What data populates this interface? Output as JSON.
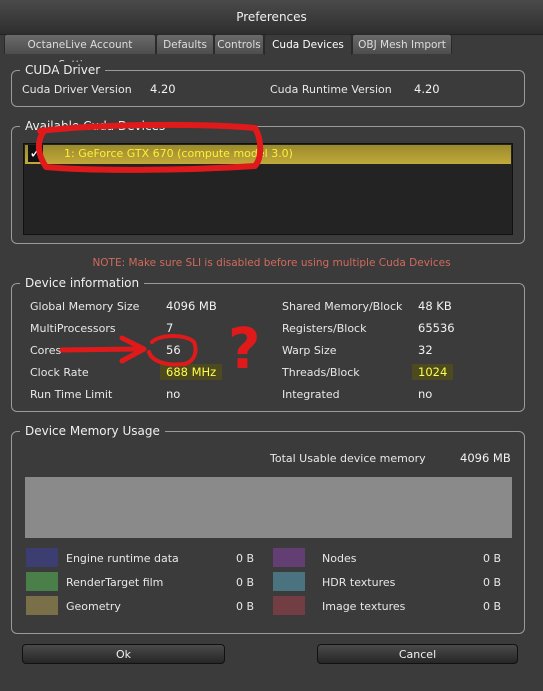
{
  "window": {
    "title": "Preferences"
  },
  "tabs": [
    {
      "label": "OctaneLive Account Settings"
    },
    {
      "label": "Defaults"
    },
    {
      "label": "Controls"
    },
    {
      "label": "Cuda Devices",
      "active": true
    },
    {
      "label": "OBJ Mesh Import"
    }
  ],
  "cuda_driver": {
    "title": "CUDA Driver",
    "driver_version_label": "Cuda Driver Version",
    "driver_version": "4.20",
    "runtime_version_label": "Cuda Runtime Version",
    "runtime_version": "4.20"
  },
  "available_devices": {
    "title": "Available Cuda Devices",
    "devices": [
      {
        "label": "1: GeForce GTX 670 (compute model 3.0)",
        "checked": true
      }
    ]
  },
  "note": "NOTE: Make sure SLI is disabled before using multiple Cuda Devices",
  "device_info": {
    "title": "Device information",
    "left": [
      {
        "label": "Global Memory Size",
        "value": "4096 MB"
      },
      {
        "label": "MultiProcessors",
        "value": "7"
      },
      {
        "label": "Cores",
        "value": "56"
      },
      {
        "label": "Clock Rate",
        "value": "688 MHz"
      },
      {
        "label": "Run Time Limit",
        "value": "no"
      }
    ],
    "right": [
      {
        "label": "Shared Memory/Block",
        "value": "48 KB"
      },
      {
        "label": "Registers/Block",
        "value": "65536"
      },
      {
        "label": "Warp Size",
        "value": "32"
      },
      {
        "label": "Threads/Block",
        "value": "1024"
      },
      {
        "label": "Integrated",
        "value": "no"
      }
    ]
  },
  "memory_usage": {
    "title": "Device Memory Usage",
    "total_label": "Total Usable device memory",
    "total_value": "4096 MB",
    "legend": [
      {
        "label": "Engine runtime data",
        "value": "0 B",
        "color": "#3d3f7c"
      },
      {
        "label": "RenderTarget film",
        "value": "0 B",
        "color": "#4f8c4e"
      },
      {
        "label": "Geometry",
        "value": "0 B",
        "color": "#857a4c"
      },
      {
        "label": "Nodes",
        "value": "0 B",
        "color": "#6a3f7c"
      },
      {
        "label": "HDR textures",
        "value": "0 B",
        "color": "#4e7c8c"
      },
      {
        "label": "Image textures",
        "value": "0 B",
        "color": "#7c3f45"
      }
    ]
  },
  "buttons": {
    "ok": "Ok",
    "cancel": "Cancel"
  },
  "annotations": {
    "question_mark": "?",
    "color": "#e01a1a"
  }
}
